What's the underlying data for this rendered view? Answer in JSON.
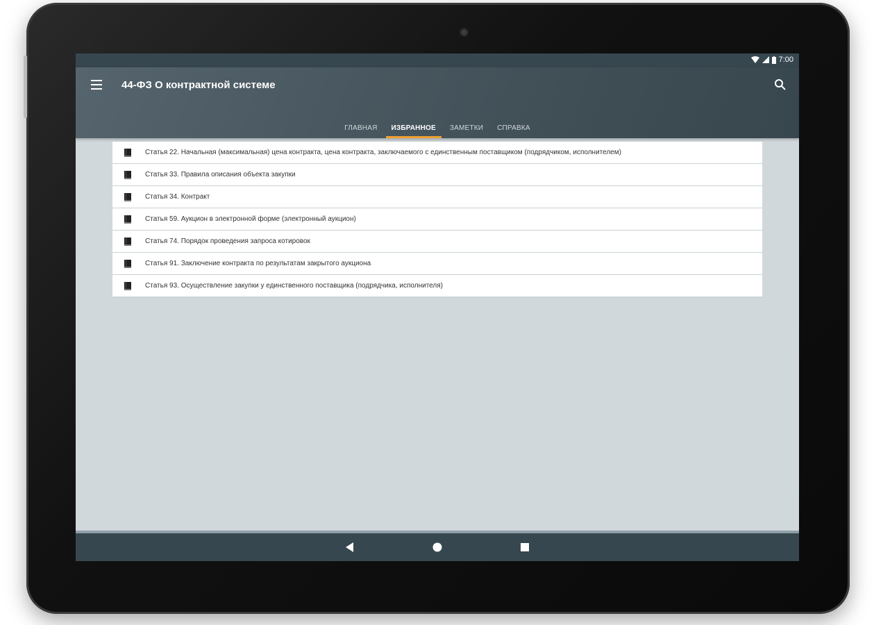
{
  "status_bar": {
    "time": "7:00"
  },
  "app_bar": {
    "title": "44-ФЗ О контрактной системе"
  },
  "tabs": [
    {
      "label": "ГЛАВНАЯ",
      "active": false
    },
    {
      "label": "ИЗБРАННОЕ",
      "active": true
    },
    {
      "label": "ЗАМЕТКИ",
      "active": false
    },
    {
      "label": "СПРАВКА",
      "active": false
    }
  ],
  "favorites": [
    {
      "text": "Статья 22. Начальная (максимальная) цена контракта, цена контракта, заключаемого с единственным поставщиком (подрядчиком, исполнителем)",
      "icon": "book-icon"
    },
    {
      "text": "Статья 33. Правила описания объекта закупки",
      "icon": "book-icon"
    },
    {
      "text": "Статья 34. Контракт",
      "icon": "book-icon"
    },
    {
      "text": "Статья 59. Аукцион в электронной форме (электронный аукцион)",
      "icon": "book-icon"
    },
    {
      "text": "Статья 74. Порядок проведения запроса котировок",
      "icon": "book-icon"
    },
    {
      "text": "Статья 91. Заключение контракта по результатам закрытого аукциона",
      "icon": "book-icon"
    },
    {
      "text": "Статья 93. Осуществление закупки у единственного поставщика (подрядчика, исполнителя)",
      "icon": "book-icon"
    }
  ],
  "colors": {
    "app_bar": "#4a5961",
    "tab_indicator": "#f0a030",
    "background": "#d1d8dc",
    "nav_bar": "#37474f"
  }
}
